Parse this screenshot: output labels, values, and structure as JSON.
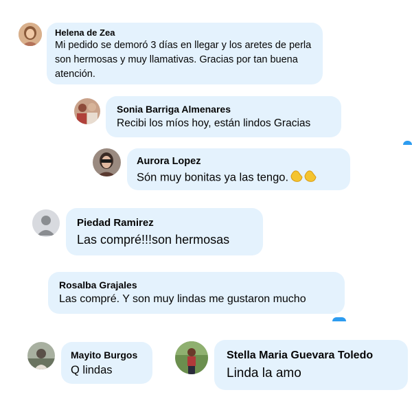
{
  "comments": [
    {
      "author": "Helena de Zea",
      "text": "Mi pedido se demoró 3 días en llegar y los aretes de perla son hermosas y muy llamativas. Gracias por tan buena atención.",
      "avatar_icon": "user-photo-woman"
    },
    {
      "author": "Sonia Barriga Almenares",
      "text": "Recibi los míos hoy, están lindos Gracias",
      "avatar_icon": "user-photo-group"
    },
    {
      "author": "Aurora Lopez",
      "text": "Són muy bonitas ya las tengo.",
      "emoji": "clapping-hands-icon",
      "avatar_icon": "user-photo-sunglasses"
    },
    {
      "author": "Piedad Ramirez",
      "text": "Las compré!!!son hermosas",
      "avatar_icon": "default-user-silhouette"
    },
    {
      "author": "Rosalba Grajales",
      "text": "Las compré. Y son muy lindas me gustaron mucho"
    },
    {
      "author": "Mayito Burgos",
      "text": "Q lindas",
      "avatar_icon": "user-photo-landscape"
    },
    {
      "author": "Stella Maria Guevara Toledo",
      "text": "Linda la amo",
      "avatar_icon": "user-photo-outdoor"
    }
  ],
  "colors": {
    "bubble_background": "#e4f2fd",
    "text": "#050505",
    "accent": "#2d9cf0"
  }
}
